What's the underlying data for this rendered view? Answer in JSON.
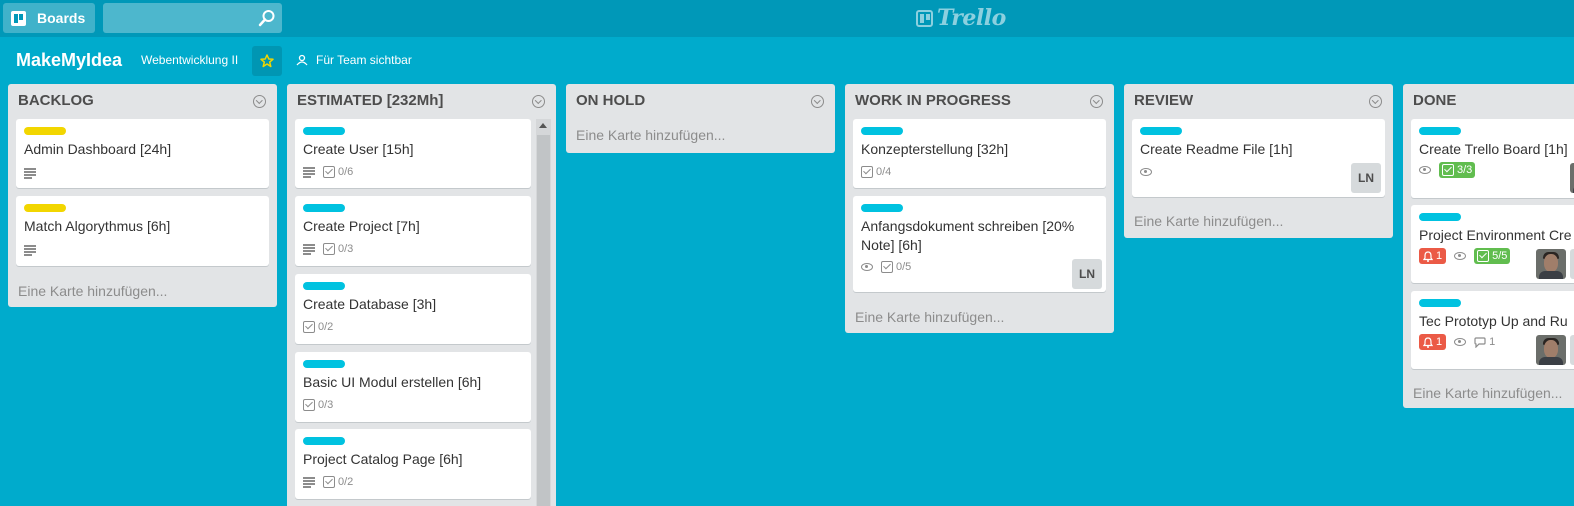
{
  "header": {
    "boards_label": "Boards",
    "search": {
      "value": "",
      "placeholder": ""
    },
    "logo_text": "Trello"
  },
  "board": {
    "title": "MakeMyIdea",
    "team": "Webentwicklung II",
    "visibility": "Für Team sichtbar"
  },
  "add_card_label": "Eine Karte hinzufügen...",
  "lists": [
    {
      "title": "BACKLOG",
      "cards": [
        {
          "label_color": "yellow",
          "title": "Admin Dashboard [24h]",
          "badges": [
            "description-icon"
          ]
        },
        {
          "label_color": "yellow",
          "title": "Match Algorythmus [6h]",
          "badges": [
            "description-icon"
          ]
        }
      ]
    },
    {
      "title": "ESTIMATED [232Mh]",
      "cards": [
        {
          "label_color": "blue",
          "title": "Create User [15h]",
          "checklist": "0/6"
        },
        {
          "label_color": "blue",
          "title": "Create Project [7h]",
          "checklist": "0/3"
        },
        {
          "label_color": "blue",
          "title": "Create Database [3h]",
          "checklist": "0/2"
        },
        {
          "label_color": "blue",
          "title": "Basic UI Modul erstellen [6h]",
          "checklist": "0/3"
        },
        {
          "label_color": "blue",
          "title": "Project Catalog Page [6h]",
          "checklist": "0/2"
        }
      ]
    },
    {
      "title": "ON HOLD",
      "cards": []
    },
    {
      "title": "WORK IN PROGRESS",
      "cards": [
        {
          "label_color": "blue",
          "title": "Konzepterstellung [32h]",
          "checklist": "0/4"
        },
        {
          "label_color": "blue",
          "title": "Anfangsdokument schreiben [20% Note] [6h]",
          "checklist": "0/5",
          "member": "LN"
        }
      ]
    },
    {
      "title": "REVIEW",
      "cards": [
        {
          "label_color": "blue",
          "title": "Create Readme File [1h]",
          "member": "LN"
        }
      ]
    },
    {
      "title": "DONE",
      "cards": [
        {
          "label_color": "blue",
          "title": "Create Trello Board [1h]",
          "checklist": "3/3"
        },
        {
          "label_color": "blue",
          "title": "Project Environment Cre",
          "notifications": "1",
          "checklist": "5/5"
        },
        {
          "label_color": "blue",
          "title": "Tec Prototyp Up and Ru",
          "notifications": "1",
          "comments": "1"
        }
      ]
    }
  ],
  "colors": {
    "background": "#00abcc",
    "header": "#0098b8",
    "label_yellow": "#f2d600",
    "label_blue": "#00c2e0",
    "badge_green": "#61bd4f",
    "badge_red": "#eb5a46"
  }
}
